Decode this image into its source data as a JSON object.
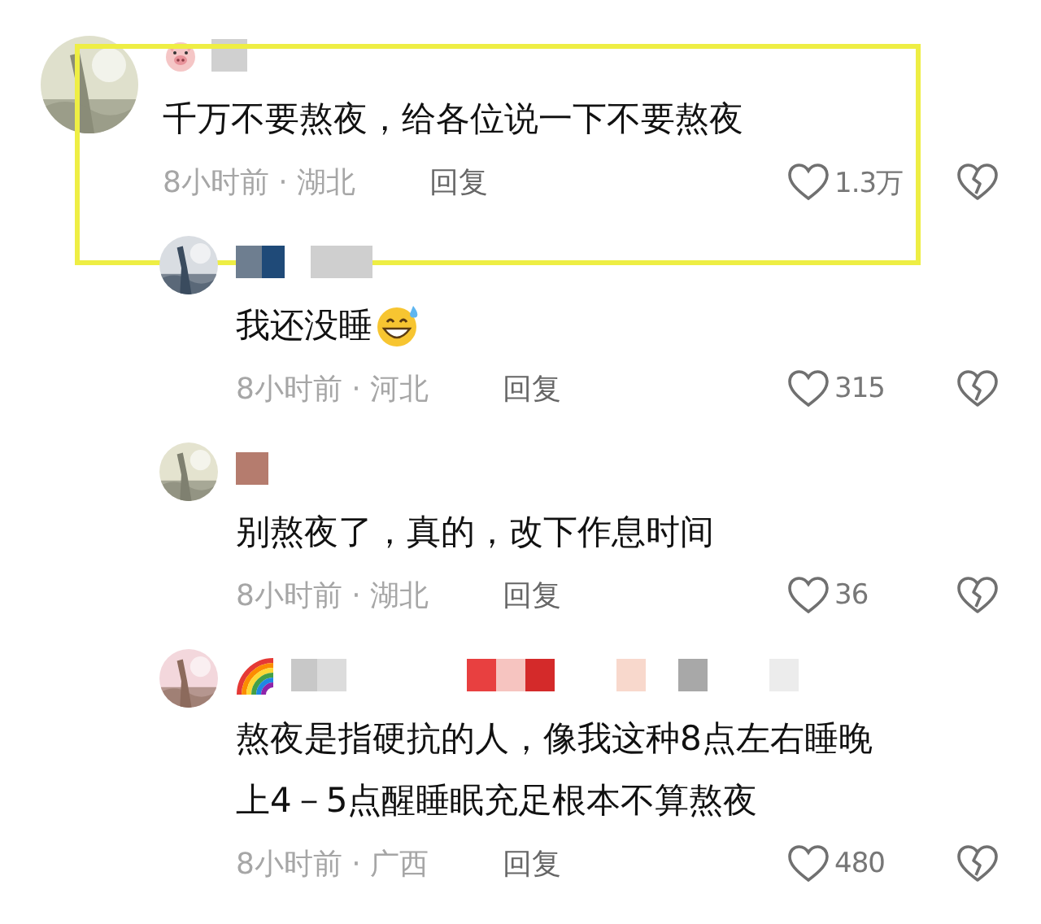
{
  "comments": [
    {
      "badge": {
        "kind": "pig"
      },
      "text": "千万不要熬夜，给各位说一下不要熬夜",
      "time_location": "8小时前 · 湖北",
      "reply": "回复",
      "likes": "1.3万",
      "highlighted": true,
      "children": [
        {
          "text": "我还没睡",
          "emoji": {
            "kind": "grin-sweat"
          },
          "time_location": "8小时前 · 河北",
          "reply": "回复",
          "likes": "315",
          "highlighted": false
        },
        {
          "text": "别熬夜了，真的，改下作息时间",
          "time_location": "8小时前 · 湖北",
          "reply": "回复",
          "likes": "36",
          "highlighted": false
        },
        {
          "badge": {
            "kind": "rainbow"
          },
          "text": "熬夜是指硬抗的人，像我这种8点左右睡晚上4－5点醒睡眠充足根本不算熬夜",
          "time_location": "8小时前 · 广西",
          "reply": "回复",
          "likes": "480",
          "highlighted": false
        }
      ]
    }
  ]
}
